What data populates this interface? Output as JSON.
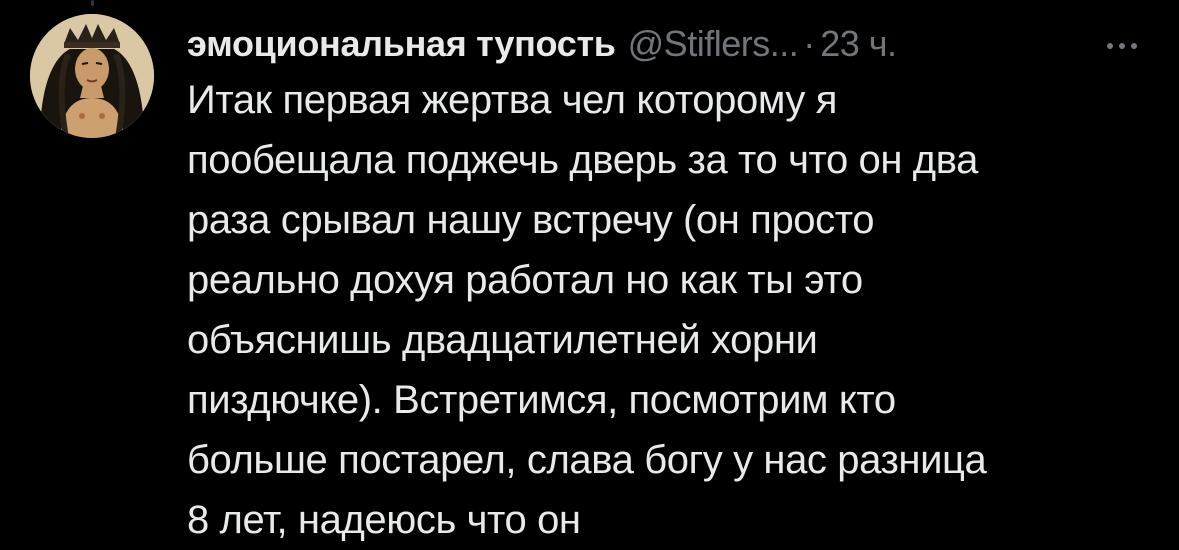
{
  "author": {
    "display_name": "эмоциональная тупость",
    "handle": "@Stiflers...",
    "separator": "·",
    "time": "23 ч.",
    "avatar_icon": "avatar-image"
  },
  "actions": {
    "more_icon": "more-horizontal-icon"
  },
  "tweet": {
    "lines": [
      "Итак первая жертва чел которому я",
      "пообещала поджечь дверь за то что он два",
      "раза срывал нашу встречу (он просто",
      "реально дохуя работал но как ты это",
      "объяснишь двадцатилетней хорни",
      "пиздючке). Встретимся, посмотрим кто",
      "больше постарел, слава богу у нас разница",
      "8 лет,  надеюсь что он"
    ]
  },
  "colors": {
    "background": "#000000",
    "text_primary": "#e7e9ea",
    "text_secondary": "#71767b",
    "thread_line": "#333639"
  }
}
